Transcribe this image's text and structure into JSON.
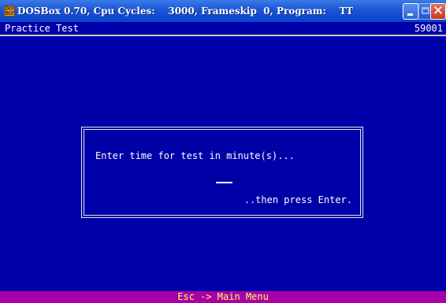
{
  "titlebar": {
    "title": "DOSBox 0.70, Cpu Cycles:    3000, Frameskip  0, Program:    TT",
    "icon": "dosbox-app-icon"
  },
  "header": {
    "title": "Practice Test",
    "code": "59001"
  },
  "dialog": {
    "prompt": "Enter time for test in minute(s)...",
    "hint": "..then press Enter.",
    "input_value": ""
  },
  "footer": {
    "hint": "Esc -> Main Menu"
  },
  "colors": {
    "background": "#0000a8",
    "footer_bg": "#a800a8",
    "footer_text": "#ffff55",
    "text": "#ffffff"
  }
}
